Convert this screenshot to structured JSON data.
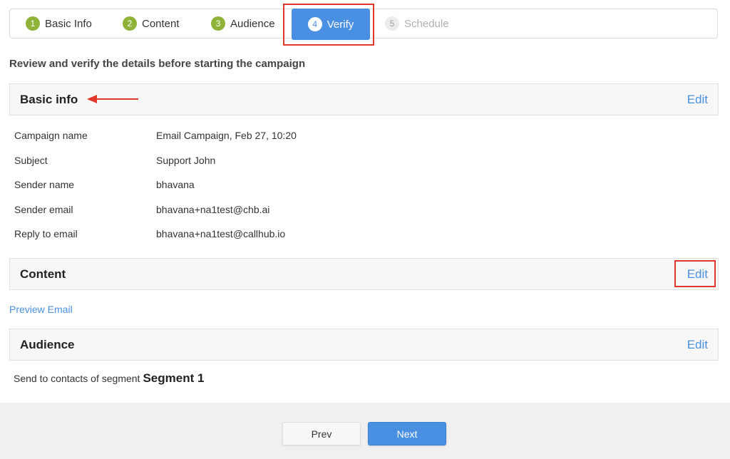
{
  "stepper": {
    "steps": [
      {
        "num": "1",
        "label": "Basic Info"
      },
      {
        "num": "2",
        "label": "Content"
      },
      {
        "num": "3",
        "label": "Audience"
      },
      {
        "num": "4",
        "label": "Verify"
      },
      {
        "num": "5",
        "label": "Schedule"
      }
    ],
    "active_step": 4
  },
  "intro": "Review and verify the details before starting the campaign",
  "sections": {
    "basic_info": {
      "title": "Basic info",
      "edit_label": "Edit",
      "rows": [
        {
          "key": "Campaign name",
          "value": "Email Campaign, Feb 27, 10:20"
        },
        {
          "key": "Subject",
          "value": "Support John"
        },
        {
          "key": "Sender name",
          "value": "bhavana"
        },
        {
          "key": "Sender email",
          "value": "bhavana+na1test@chb.ai"
        },
        {
          "key": "Reply to email",
          "value": "bhavana+na1test@callhub.io"
        }
      ]
    },
    "content": {
      "title": "Content",
      "edit_label": "Edit",
      "preview_label": "Preview Email"
    },
    "audience": {
      "title": "Audience",
      "edit_label": "Edit",
      "segment_prefix": "Send to contacts of segment",
      "segment_name": "Segment 1"
    }
  },
  "footer": {
    "prev_label": "Prev",
    "next_label": "Next"
  },
  "colors": {
    "accent": "#4a90e2",
    "step_done": "#8fb339",
    "annotation": "#e0392b"
  }
}
